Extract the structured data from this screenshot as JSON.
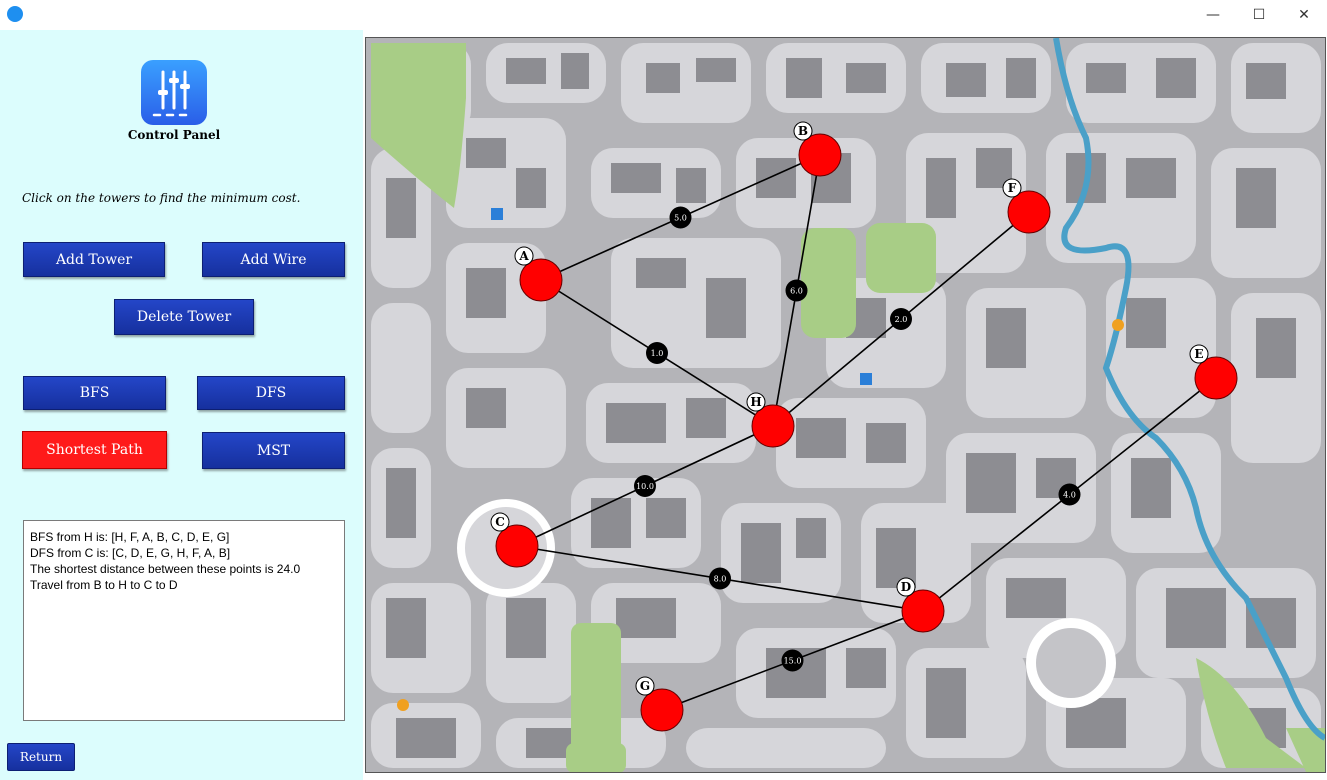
{
  "window": {
    "minimize": "—",
    "maximize": "☐",
    "close": "✕"
  },
  "control_panel": {
    "title": "Control Panel",
    "icon": "sliders-icon",
    "instruction": "Click on the towers to find the minimum cost.",
    "buttons": {
      "add_tower": "Add Tower",
      "add_wire": "Add Wire",
      "delete_tower": "Delete Tower",
      "bfs": "BFS",
      "dfs": "DFS",
      "shortest_path": "Shortest Path",
      "mst": "MST"
    },
    "active_button": "shortest_path",
    "output": [
      "BFS from H is: [H, F, A, B, C, D, E, G]",
      "DFS from C is: [C, D, E, G, H, F, A, B]",
      "The shortest distance between these points is 24.0",
      "Travel from B to H to C to D"
    ],
    "return": "Return"
  },
  "colors": {
    "panel_bg": "#dcfdfd",
    "button_blue": "#1f3fb8",
    "active_red": "#ff1a1a",
    "tower_red": "#ff0000",
    "weight_bg": "#000000"
  },
  "graph": {
    "nodes": [
      "A",
      "B",
      "C",
      "D",
      "E",
      "F",
      "G",
      "H"
    ],
    "edges": [
      {
        "from": "A",
        "to": "B",
        "weight": "5.0"
      },
      {
        "from": "A",
        "to": "H",
        "weight": "1.0"
      },
      {
        "from": "B",
        "to": "H",
        "weight": "6.0"
      },
      {
        "from": "F",
        "to": "H",
        "weight": "2.0"
      },
      {
        "from": "H",
        "to": "C",
        "weight": "10.0"
      },
      {
        "from": "C",
        "to": "D",
        "weight": "8.0"
      },
      {
        "from": "D",
        "to": "E",
        "weight": "4.0"
      },
      {
        "from": "D",
        "to": "G",
        "weight": "15.0"
      }
    ]
  }
}
